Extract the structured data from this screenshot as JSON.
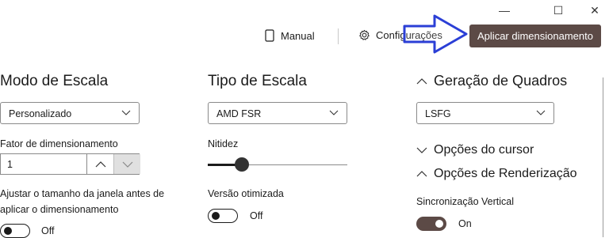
{
  "window_controls": {
    "minimize": "—",
    "maximize": "☐",
    "close": "✕"
  },
  "toolbar": {
    "manual_label": "Manual",
    "settings_label": "Configurações",
    "apply_label": "Aplicar dimensionamento"
  },
  "scale_mode": {
    "heading": "Modo de Escala",
    "selected": "Personalizado",
    "factor_label": "Fator de dimensionamento",
    "factor_value": "1",
    "adjust_label_line1": "Ajustar o tamanho da janela antes de",
    "adjust_label_line2": "aplicar o dimensionamento",
    "adjust_state": "Off"
  },
  "scale_type": {
    "heading": "Tipo de Escala",
    "selected": "AMD FSR",
    "sharpness_label": "Nitidez",
    "sharpness_value": 0.3,
    "optimized_label": "Versão otimizada",
    "optimized_state": "Off"
  },
  "frame_gen": {
    "heading": "Geração de Quadros",
    "selected": "LSFG",
    "cursor_options": "Opções do cursor",
    "render_options": "Opções de Renderização",
    "vsync_label": "Sincronização Vertical",
    "vsync_state": "On"
  },
  "colors": {
    "accent": "#5c4a46",
    "arrow": "#2b3fd6"
  }
}
